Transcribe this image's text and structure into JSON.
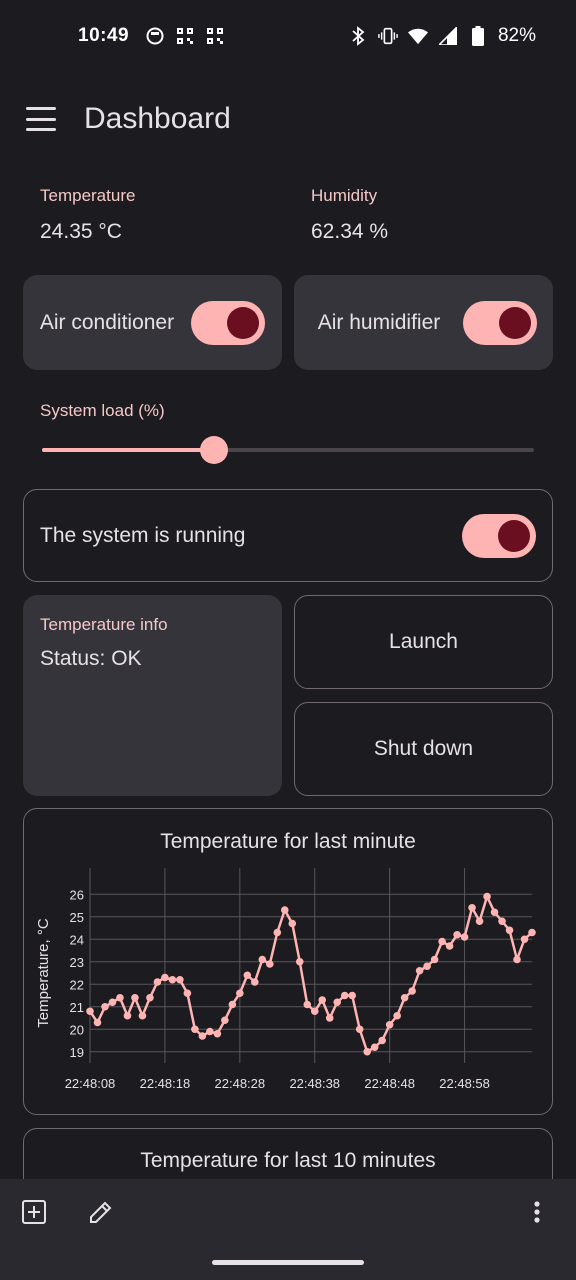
{
  "status_bar": {
    "time": "10:49",
    "battery": "82%"
  },
  "app_bar": {
    "title": "Dashboard"
  },
  "readings": [
    {
      "label": "Temperature",
      "value": "24.35 °C"
    },
    {
      "label": "Humidity",
      "value": "62.34 %"
    }
  ],
  "toggles": {
    "air_conditioner": {
      "label": "Air conditioner",
      "on": true
    },
    "air_humidifier": {
      "label": "Air humidifier",
      "on": true
    }
  },
  "system_load": {
    "label": "System load (%)",
    "value": 35
  },
  "system_running": {
    "label": "The system is running",
    "on": true
  },
  "temperature_info": {
    "title": "Temperature info",
    "status": "Status: OK"
  },
  "buttons": {
    "launch": "Launch",
    "shut_down": "Shut down"
  },
  "colors": {
    "accent": "#ffb4b4",
    "knob": "#690f1f",
    "background": "#1c1b1f",
    "card": "#36343b"
  },
  "chart_data": {
    "type": "line",
    "title": "Temperature for last minute",
    "ylabel": "Temperature, °C",
    "xlabel": "",
    "ylim": [
      18.5,
      26.5
    ],
    "yticks": [
      19,
      20,
      21,
      22,
      23,
      24,
      25,
      26
    ],
    "xlim": [
      0,
      59
    ],
    "xticks": [
      {
        "x": 0,
        "label": "22:48:08"
      },
      {
        "x": 10,
        "label": "22:48:18"
      },
      {
        "x": 20,
        "label": "22:48:28"
      },
      {
        "x": 30,
        "label": "22:48:38"
      },
      {
        "x": 40,
        "label": "22:48:48"
      },
      {
        "x": 50,
        "label": "22:48:58"
      }
    ],
    "grid": true,
    "color": "#ffb4b4",
    "series": [
      {
        "values": [
          20.8,
          20.3,
          21.0,
          21.2,
          21.4,
          20.6,
          21.4,
          20.6,
          21.4,
          22.1,
          22.3,
          22.2,
          22.2,
          21.6,
          20.0,
          19.7,
          19.9,
          19.8,
          20.4,
          21.1,
          21.6,
          22.4,
          22.1,
          23.1,
          22.9,
          24.3,
          25.3,
          24.7,
          23.0,
          21.1,
          20.8,
          21.3,
          20.5,
          21.2,
          21.5,
          21.5,
          20.0,
          19.0,
          19.2,
          19.5,
          20.2,
          20.6,
          21.4,
          21.7,
          22.6,
          22.8,
          23.1,
          23.9,
          23.7,
          24.2,
          24.1,
          25.4,
          24.8,
          25.9,
          25.2,
          24.8,
          24.4,
          23.1,
          24.0,
          24.3
        ]
      }
    ]
  },
  "chart2": {
    "title": "Temperature for last 10 minutes"
  }
}
